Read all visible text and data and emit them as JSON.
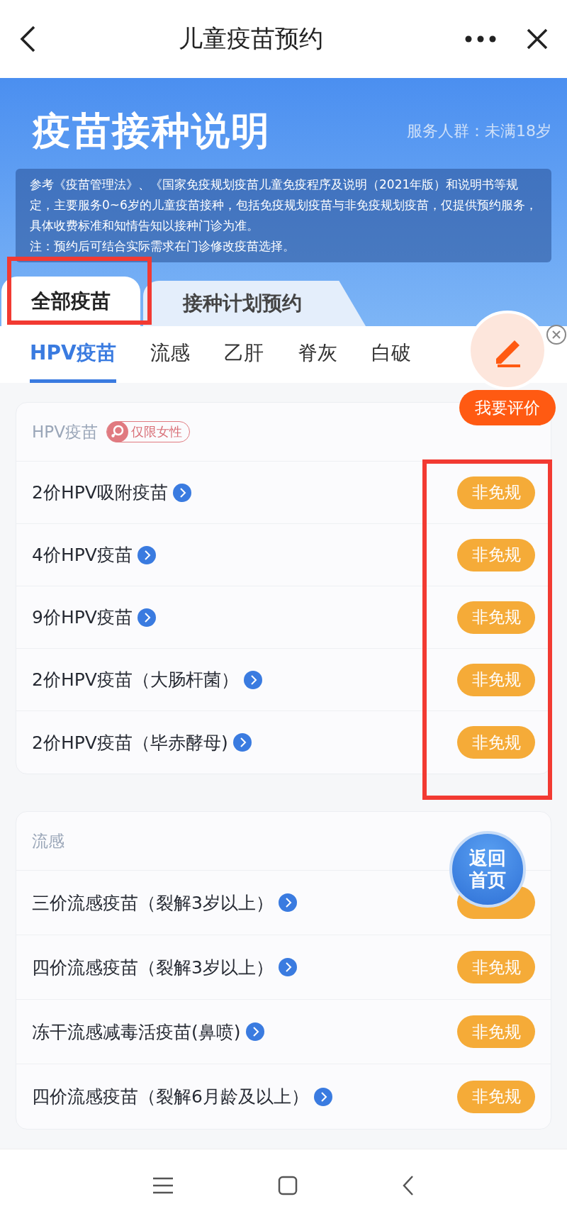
{
  "top_bar": {
    "title": "儿童疫苗预约"
  },
  "banner": {
    "title": "疫苗接种说明",
    "audience": "服务人群：未满18岁",
    "notice": [
      "参考《疫苗管理法》、《国家免疫规划疫苗儿童免疫程序及说明（2021年版）和说明书等规定，主要服务0~6岁的儿童疫苗接种，包括免疫规划疫苗与非免疫规划疫苗，仅提供预约服务，具体收费标准和知情告知以接种门诊为准。",
      "注：预约后可结合实际需求在门诊修改疫苗选择。"
    ]
  },
  "tabs": [
    {
      "label": "全部疫苗",
      "selected": true
    },
    {
      "label": "接种计划预约",
      "selected": false
    }
  ],
  "categories": [
    {
      "label": "HPV疫苗",
      "selected": true
    },
    {
      "label": "流感",
      "selected": false
    },
    {
      "label": "乙肝",
      "selected": false
    },
    {
      "label": "脊灰",
      "selected": false
    },
    {
      "label": "白破",
      "selected": false
    }
  ],
  "sections": [
    {
      "title": "HPV疫苗",
      "badge": "仅限女性",
      "items": [
        {
          "name": "2价HPV吸附疫苗",
          "tag": "非免规"
        },
        {
          "name": "4价HPV疫苗",
          "tag": "非免规"
        },
        {
          "name": "9价HPV疫苗",
          "tag": "非免规"
        },
        {
          "name": "2价HPV疫苗（大肠杆菌）",
          "tag": "非免规"
        },
        {
          "name": "2价HPV疫苗（毕赤酵母)",
          "tag": "非免规"
        }
      ]
    },
    {
      "title": "流感",
      "items": [
        {
          "name": "三价流感疫苗（裂解3岁以上）"
        },
        {
          "name": "四价流感疫苗（裂解3岁以上）",
          "tag": "非免规"
        },
        {
          "name": "冻干流感减毒活疫苗(鼻喷)",
          "tag": "非免规"
        },
        {
          "name": "四价流感疫苗（裂解6月龄及以上）",
          "tag": "非免规"
        }
      ]
    }
  ],
  "review_button": {
    "label": "我要评价"
  },
  "home_button": {
    "label": "返回首页"
  },
  "highlight_frames": {
    "tabs": true,
    "tags": true
  }
}
